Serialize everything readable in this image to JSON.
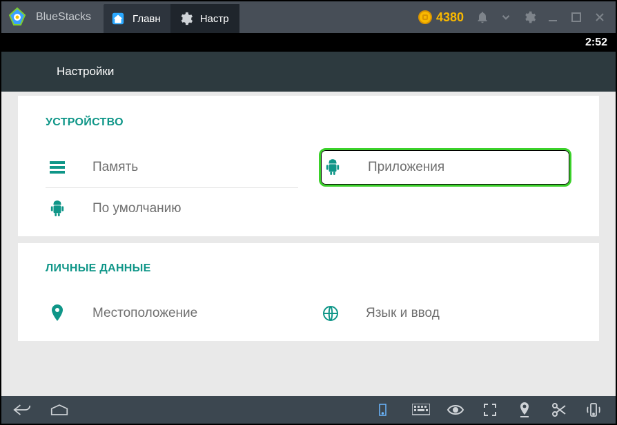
{
  "titlebar": {
    "app_name": "BlueStacks",
    "tabs": [
      {
        "label": "Главн"
      },
      {
        "label": "Настр"
      }
    ],
    "coin_count": "4380"
  },
  "statusbar": {
    "time": "2:52"
  },
  "appbar": {
    "title": "Настройки"
  },
  "sections": {
    "device": {
      "title": "УСТРОЙСТВО",
      "items": {
        "storage": "Память",
        "apps": "Приложения",
        "default": "По умолчанию"
      }
    },
    "personal": {
      "title": "ЛИЧНЫЕ ДАННЫЕ",
      "items": {
        "location": "Местоположение",
        "language": "Язык и ввод"
      }
    }
  }
}
